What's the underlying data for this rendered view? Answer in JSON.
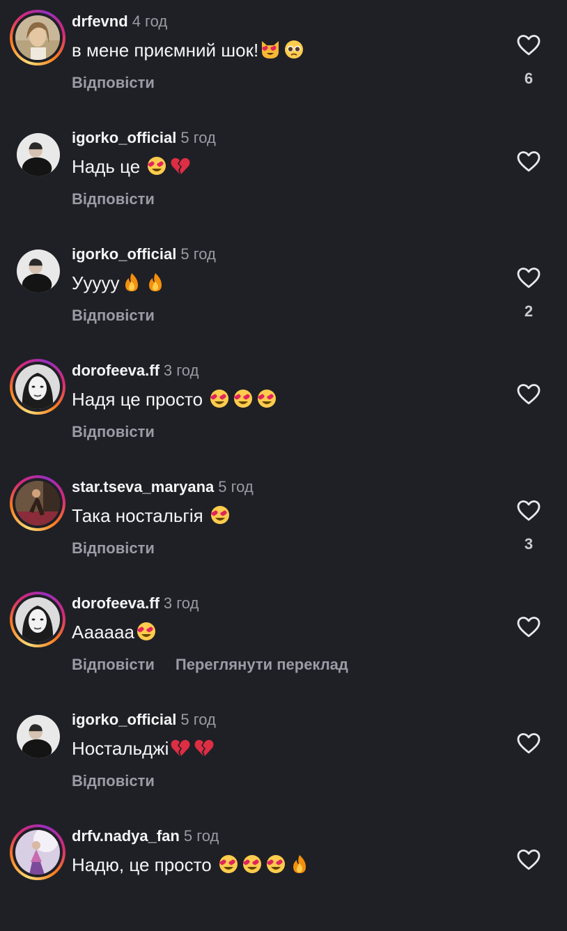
{
  "colors": {
    "background": "#1f2026",
    "username": "#f5f5f7",
    "muted": "#9a9ca5"
  },
  "comments": [
    {
      "username": "drfevnd",
      "time": "4 год",
      "text": "в мене приємний шок!",
      "emojis": [
        "smiling-cat-heart-eyes-emoji",
        "pleading-face-emoji"
      ],
      "reply": "Відповісти",
      "likes": "6",
      "story_ring": true
    },
    {
      "username": "igorko_official",
      "time": "5 год",
      "text": "Надь це ",
      "emojis": [
        "heart-eyes-emoji",
        "broken-heart-emoji"
      ],
      "reply": "Відповісти",
      "likes": "",
      "story_ring": false
    },
    {
      "username": "igorko_official",
      "time": "5 год",
      "text": "Ууууу",
      "emojis": [
        "fire-emoji",
        "fire-emoji"
      ],
      "reply": "Відповісти",
      "likes": "2",
      "story_ring": false
    },
    {
      "username": "dorofeeva.ff",
      "time": "3 год",
      "text": "Надя це просто ",
      "emojis": [
        "heart-eyes-emoji",
        "heart-eyes-emoji",
        "heart-eyes-emoji"
      ],
      "reply": "Відповісти",
      "likes": "",
      "story_ring": true
    },
    {
      "username": "star.tseva_maryana",
      "time": "5 год",
      "text": "Така ностальгія ",
      "emojis": [
        "heart-eyes-emoji"
      ],
      "reply": "Відповісти",
      "likes": "3",
      "story_ring": true
    },
    {
      "username": "dorofeeva.ff",
      "time": "3 год",
      "text": "Аааааа",
      "emojis": [
        "heart-eyes-emoji"
      ],
      "reply": "Відповісти",
      "translate": "Переглянути переклад",
      "likes": "",
      "story_ring": true
    },
    {
      "username": "igorko_official",
      "time": "5 год",
      "text": "Ностальджі",
      "emojis": [
        "broken-heart-emoji",
        "broken-heart-emoji"
      ],
      "reply": "Відповісти",
      "likes": "",
      "story_ring": false
    },
    {
      "username": "drfv.nadya_fan",
      "time": "5 год",
      "text": "Надю, це просто ",
      "emojis": [
        "heart-eyes-emoji",
        "heart-eyes-emoji",
        "heart-eyes-emoji",
        "fire-emoji"
      ],
      "reply": "",
      "likes": "",
      "story_ring": true
    }
  ]
}
